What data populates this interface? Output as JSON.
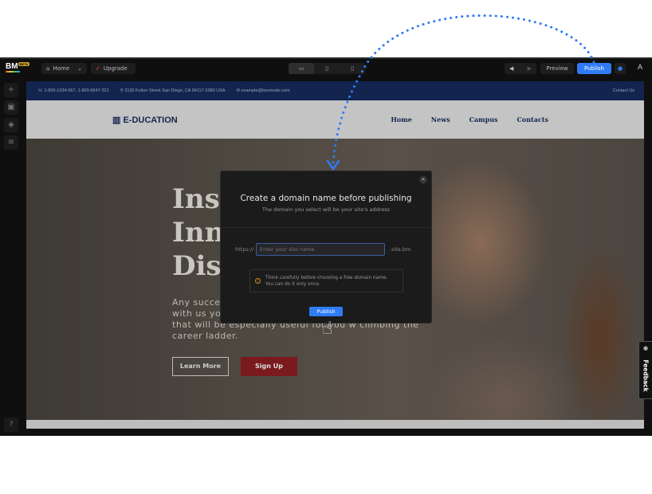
{
  "topbar": {
    "logo": "BM",
    "beta": "BETA",
    "page_select": "Home",
    "upgrade": "Upgrade",
    "devices": [
      "desktop-icon",
      "tablet-icon",
      "mobile-icon"
    ],
    "preview": "Preview",
    "publish": "Publish",
    "avatar": "A"
  },
  "sidebar": {
    "items": [
      "add-icon",
      "media-icon",
      "layers-icon",
      "settings-sliders-icon"
    ],
    "help": "help-icon"
  },
  "site": {
    "info": {
      "phone": "1-800-1234-567, 1-800-6547-321",
      "address": "2130 Fulton Street San Diego, CA 94117-1080 USA",
      "email": "example@boxmode.com",
      "contact": "Contact Us"
    },
    "brand": "E-DUCATION",
    "menu": [
      "Home",
      "News",
      "Campus",
      "Contacts"
    ],
    "hero": {
      "lines": [
        "Insp",
        "Inn",
        "Disc"
      ],
      "paragraph": [
        "Any success",
        "with us you",
        "that will be especially useful for you w   climbing the",
        "career ladder."
      ],
      "learn_more": "Learn More",
      "sign_up": "Sign Up"
    }
  },
  "modal": {
    "title": "Create a domain name before publishing",
    "subtitle": "The domain you select will be your site's address",
    "prefix": "https://",
    "placeholder": "Enter your site name",
    "value": "",
    "suffix": ".site.bm",
    "tip": [
      "Think carefully before choosing a free domain name.",
      "You can do it only once."
    ],
    "publish": "Publish"
  },
  "feedback": "Feedback",
  "colors": {
    "accent": "#2f7cf6",
    "site_navy": "#13254f",
    "sign_up": "#7a1a1e",
    "warning": "#d08a1c"
  }
}
